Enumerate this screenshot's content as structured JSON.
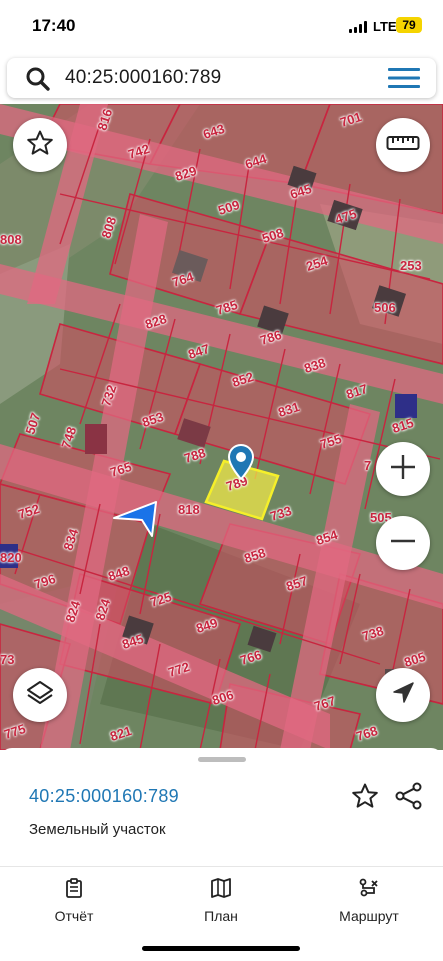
{
  "status_bar": {
    "time": "17:40",
    "network": "LTE",
    "battery": "79"
  },
  "search": {
    "query": "40:25:000160:789",
    "search_icon": "search-icon",
    "menu_icon": "hamburger-menu-icon"
  },
  "map": {
    "selected_parcel": "789",
    "parcel_labels": [
      "816",
      "643",
      "701",
      "742",
      "829",
      "644",
      "645",
      "509",
      "475",
      "808",
      "808",
      "508",
      "254",
      "253",
      "764",
      "785",
      "506",
      "828",
      "786",
      "847",
      "838",
      "852",
      "817",
      "732",
      "853",
      "831",
      "748",
      "507",
      "788",
      "755",
      "815",
      "765",
      "7",
      "818",
      "733",
      "505",
      "752",
      "834",
      "854",
      "858",
      "820",
      "796",
      "848",
      "857",
      "725",
      "824",
      "824",
      "849",
      "738",
      "845",
      "766",
      "772",
      "805",
      "73",
      "767",
      "806",
      "821",
      "775",
      "768"
    ],
    "colors": {
      "parcel_fill": "#d94b63",
      "parcel_border": "#c8253f",
      "selected_fill": "#f0e84a",
      "user_marker": "#1a73e8"
    }
  },
  "controls": {
    "favorite_icon": "star-icon",
    "ruler_icon": "ruler-icon",
    "zoom_in_icon": "plus-icon",
    "zoom_out_icon": "minus-icon",
    "layers_icon": "layers-icon",
    "locate_icon": "navigation-arrow-icon"
  },
  "sheet": {
    "cadastral_number": "40:25:000160:789",
    "object_type": "Земельный участок",
    "star_icon": "star-outline-icon",
    "share_icon": "share-icon"
  },
  "tabs": [
    {
      "label": "Отчёт",
      "icon": "clipboard-icon"
    },
    {
      "label": "План",
      "icon": "map-icon"
    },
    {
      "label": "Маршрут",
      "icon": "route-icon"
    }
  ]
}
